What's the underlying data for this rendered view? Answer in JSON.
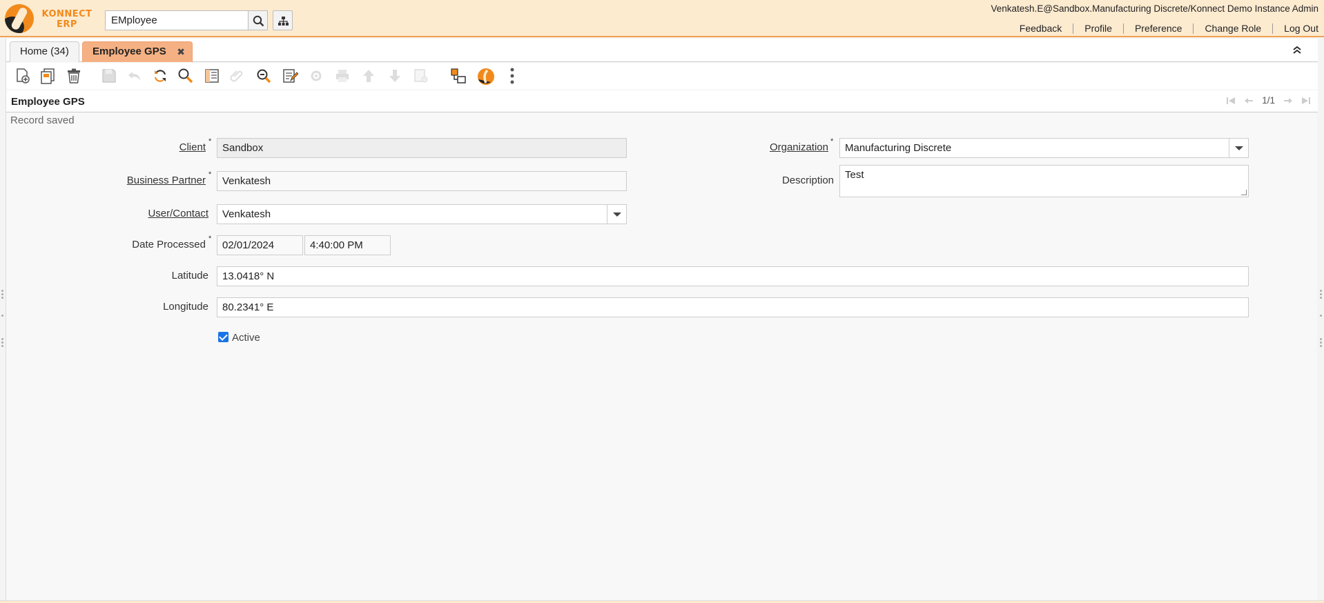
{
  "app": {
    "logo_text_line1": "KONNECT",
    "logo_text_line2": "ERP",
    "search_value": "EMployee",
    "user_info": "Venkatesh.E@Sandbox.Manufacturing Discrete/Konnect Demo Instance Admin",
    "menu": [
      "Feedback",
      "Profile",
      "Preference",
      "Change Role",
      "Log Out"
    ],
    "accent_color": "#f18a1c",
    "header_bg": "#fdebd0"
  },
  "tabs": [
    {
      "label": "Home (34)",
      "active": false
    },
    {
      "label": "Employee GPS",
      "active": true,
      "close_glyph": "✖"
    }
  ],
  "toolbar": {
    "icons": [
      "new-record-icon",
      "copy-record-icon",
      "delete-record-icon",
      "save-icon",
      "undo-icon",
      "refresh-icon",
      "find-icon",
      "grid-toggle-icon",
      "attachment-icon",
      "zoom-across-icon",
      "chat-icon",
      "process-icon",
      "print-icon",
      "previous-record-icon",
      "next-record-icon",
      "archive-icon",
      "toggle-detail-icon",
      "konnect-app-icon",
      "more-menu-icon"
    ]
  },
  "window": {
    "title": "Employee GPS",
    "record_count": "1/1",
    "status": "Record saved"
  },
  "form": {
    "client": {
      "label": "Client",
      "value": "Sandbox"
    },
    "organization": {
      "label": "Organization",
      "value": "Manufacturing Discrete"
    },
    "business_partner": {
      "label": "Business Partner",
      "value": "Venkatesh"
    },
    "description": {
      "label": "Description",
      "value": "Test"
    },
    "user_contact": {
      "label": "User/Contact",
      "value": "Venkatesh"
    },
    "date_processed": {
      "label": "Date Processed",
      "date": "02/01/2024",
      "time": "4:40:00 PM"
    },
    "latitude": {
      "label": "Latitude",
      "value": "13.0418° N"
    },
    "longitude": {
      "label": "Longitude",
      "value": "80.2341° E"
    },
    "active": {
      "label": "Active",
      "checked": true
    }
  },
  "required_mark": "*"
}
